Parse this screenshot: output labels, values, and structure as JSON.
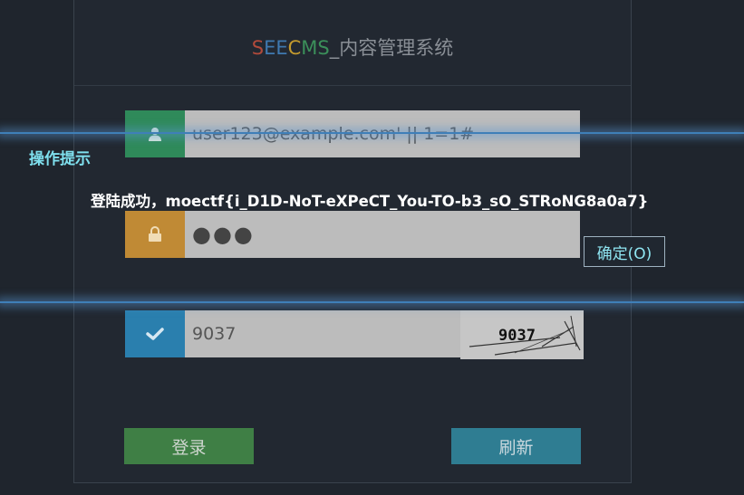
{
  "brand": {
    "part1": "S",
    "part2": "EE",
    "part3": "C",
    "part4": "MS",
    "suffix": "_内容管理系统"
  },
  "form": {
    "username_value": "user123@example.com' || 1=1#",
    "password_value": "●●●",
    "code_value": "9037",
    "captcha_text": "9037",
    "login_label": "登录",
    "refresh_label": "刷新"
  },
  "dialog": {
    "title": "操作提示",
    "message": "登陆成功，moectf{i_D1D-NoT-eXPeCT_You-TO-b3_sO_STRoNG8a0a7}",
    "ok_label": "确定(O)"
  },
  "colors": {
    "user_icon_bg": "#2f8a5a",
    "pass_icon_bg": "#c08a35",
    "code_icon_bg": "#2a7fae",
    "login_bg": "#3f7f45",
    "refresh_bg": "#2f7d92",
    "dialog_accent": "#7fe0ee"
  },
  "icons": {
    "user": "user-icon",
    "lock": "lock-icon",
    "check": "check-icon"
  }
}
